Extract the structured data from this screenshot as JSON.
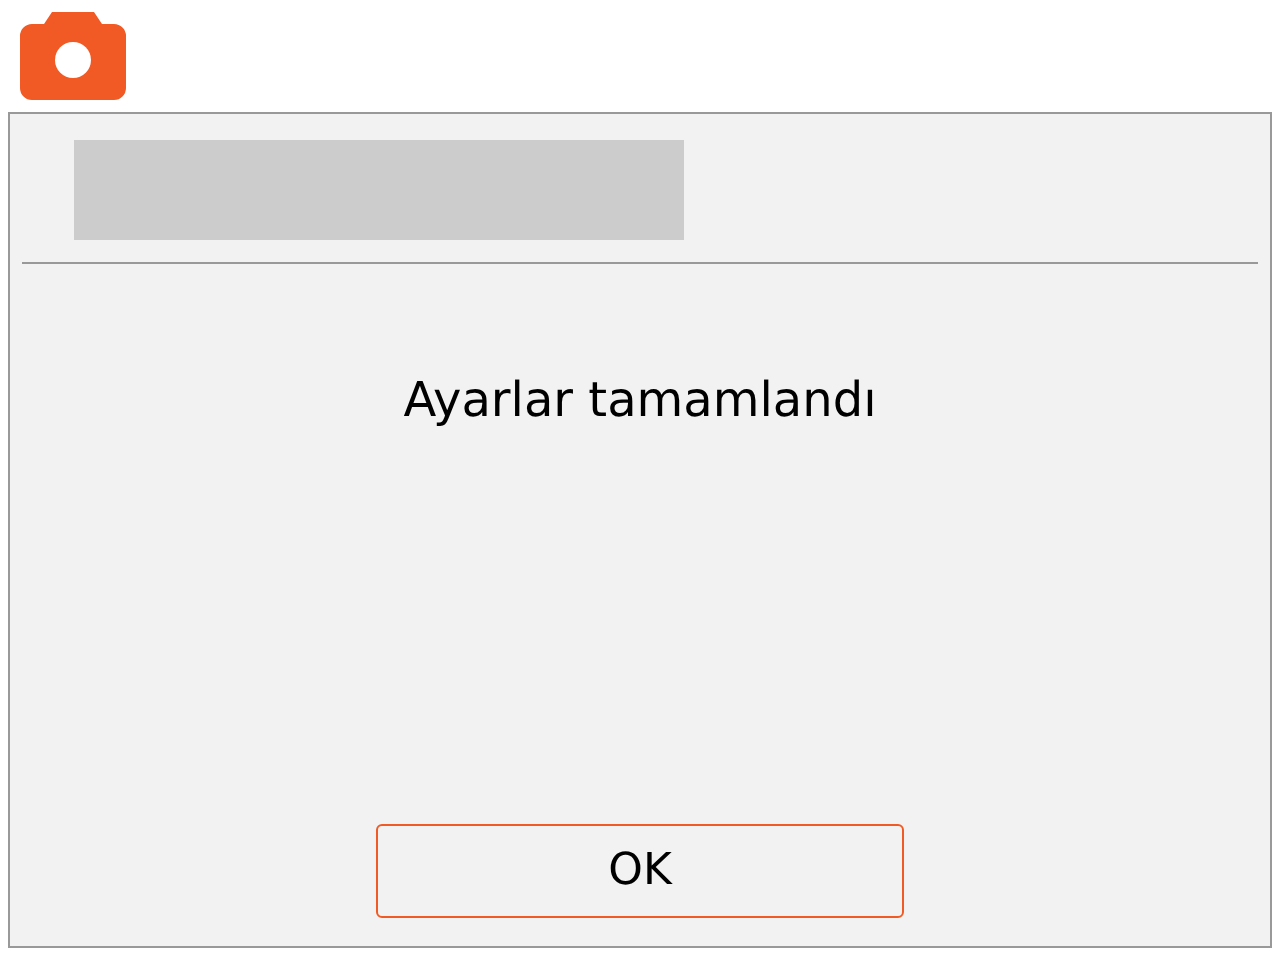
{
  "message": "Ayarlar tamamlandı",
  "buttons": [
    "OK"
  ]
}
